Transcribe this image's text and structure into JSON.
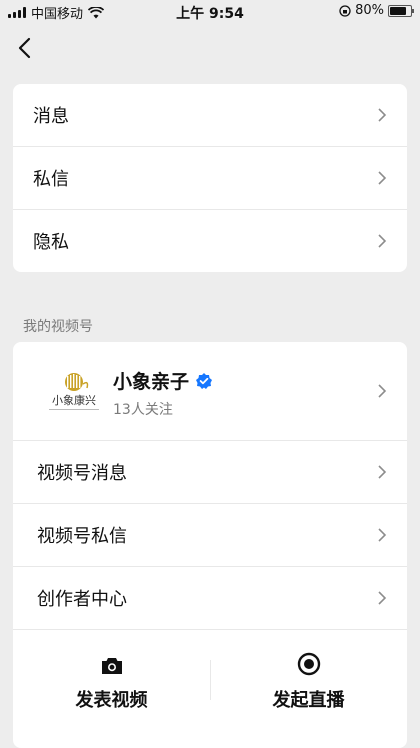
{
  "status_bar": {
    "carrier": "中国移动",
    "time": "上午 9:54",
    "battery": "80%",
    "battery_level": 0.8
  },
  "settings_card": {
    "items": [
      {
        "label": "消息",
        "icon": "chevron-right-icon"
      },
      {
        "label": "私信",
        "icon": "chevron-right-icon"
      },
      {
        "label": "隐私",
        "icon": "chevron-right-icon"
      }
    ]
  },
  "channels_section": {
    "title": "我的视频号",
    "profile": {
      "name": "小象亲子",
      "followers": "13人关注",
      "logo_text": "小象康兴"
    },
    "items": [
      {
        "label": "视频号消息"
      },
      {
        "label": "视频号私信"
      },
      {
        "label": "创作者中心"
      }
    ],
    "actions": [
      {
        "label": "发表视频",
        "icon": "camera-icon"
      },
      {
        "label": "发起直播",
        "icon": "live-record-icon"
      }
    ]
  },
  "colors": {
    "background": "#ededed",
    "card": "#ffffff",
    "verified_badge": "#1677ff",
    "logo_gold": "#c9a227"
  }
}
